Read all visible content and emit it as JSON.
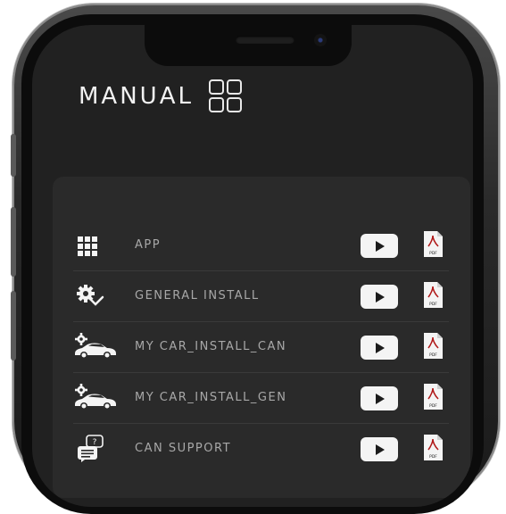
{
  "header": {
    "title": "MANUAL",
    "icon": "grid-2x2-icon"
  },
  "manual_items": [
    {
      "label": "APP",
      "icon": "app-grid-icon",
      "video_icon": "play-icon",
      "doc_icon": "pdf-icon",
      "doc_label": "PDF"
    },
    {
      "label": "GENERAL INSTALL",
      "icon": "gear-check-icon",
      "video_icon": "play-icon",
      "doc_icon": "pdf-icon",
      "doc_label": "PDF"
    },
    {
      "label": "MY CAR_INSTALL_CAN",
      "icon": "car-gear-icon",
      "video_icon": "play-icon",
      "doc_icon": "pdf-icon",
      "doc_label": "PDF"
    },
    {
      "label": "MY CAR_INSTALL_GEN",
      "icon": "car-gear-icon",
      "video_icon": "play-icon",
      "doc_icon": "pdf-icon",
      "doc_label": "PDF"
    },
    {
      "label": "CAN SUPPORT",
      "icon": "chat-support-icon",
      "video_icon": "play-icon",
      "doc_icon": "pdf-icon",
      "doc_label": "PDF"
    }
  ],
  "colors": {
    "background": "#212121",
    "panel": "#2a2a2a",
    "title_text": "#f2f2f2",
    "label_text": "#a8a8a8",
    "button_fill": "#f4f4f4"
  }
}
